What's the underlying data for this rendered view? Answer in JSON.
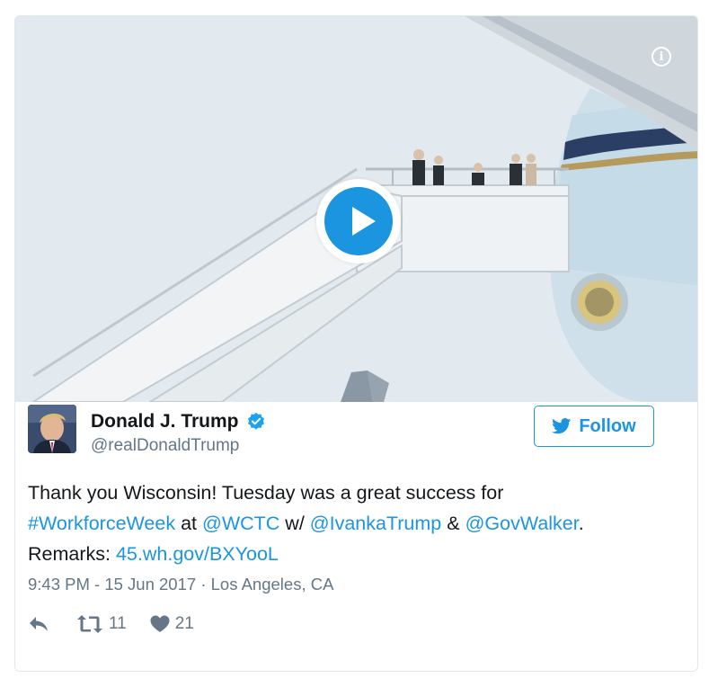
{
  "media": {
    "info_icon": "info-icon",
    "play_icon": "play-icon"
  },
  "author": {
    "display_name": "Donald J. Trump",
    "handle": "@realDonaldTrump",
    "verified_icon": "verified-badge-icon"
  },
  "follow": {
    "label": "Follow",
    "icon": "twitter-bird-icon"
  },
  "tweet": {
    "line1": "Thank you Wisconsin! Tuesday was a great success for",
    "hashtag": "#WorkforceWeek",
    "at_text": " at ",
    "mention1": "@WCTC",
    "w_text": " w/ ",
    "mention2": "@IvankaTrump",
    "amp_text": " & ",
    "mention3": "@GovWalker",
    "period": ".",
    "remarks_label": "Remarks: ",
    "link": "45.wh.gov/BXYooL"
  },
  "meta": {
    "timestamp": "9:43 PM - 15 Jun 2017",
    "separator": " · ",
    "location": "Los Angeles, CA"
  },
  "actions": {
    "reply_icon": "reply-icon",
    "retweet_icon": "retweet-icon",
    "retweet_count": "11",
    "like_icon": "heart-icon",
    "like_count": "21"
  },
  "colors": {
    "link": "#1b95e0",
    "meta": "#657786",
    "text": "#14171a",
    "border": "#e1e8ed"
  }
}
